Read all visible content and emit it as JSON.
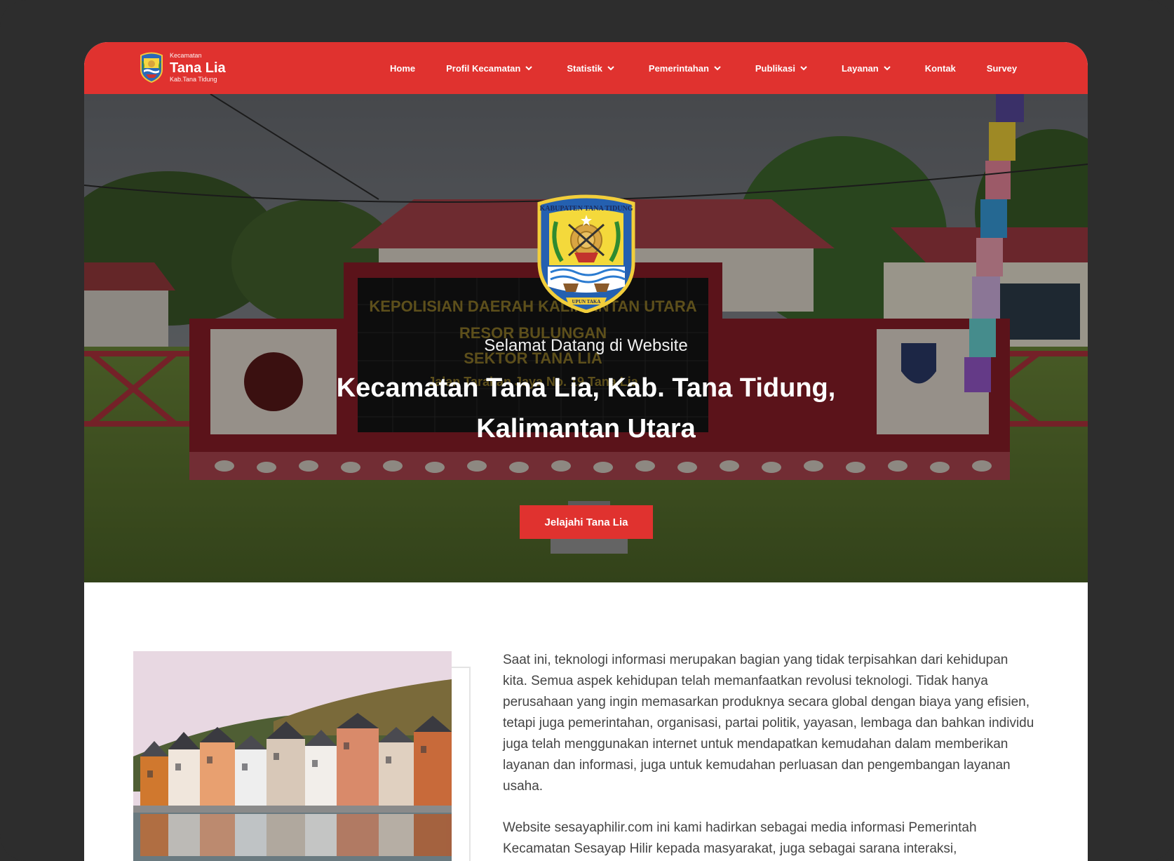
{
  "brand": {
    "small": "Kecamatan",
    "name": "Tana Lia",
    "sub": "Kab.Tana Tidung"
  },
  "nav": {
    "items": [
      {
        "label": "Home",
        "dropdown": false
      },
      {
        "label": "Profil Kecamatan",
        "dropdown": true
      },
      {
        "label": "Statistik",
        "dropdown": true
      },
      {
        "label": "Pemerintahan",
        "dropdown": true
      },
      {
        "label": "Publikasi",
        "dropdown": true
      },
      {
        "label": "Layanan",
        "dropdown": true
      },
      {
        "label": "Kontak",
        "dropdown": false
      },
      {
        "label": "Survey",
        "dropdown": false
      }
    ]
  },
  "hero": {
    "kicker": "Selamat Datang di Website",
    "title_line1": "Kecamatan Tana Lia, Kab. Tana Tidung,",
    "title_line2": "Kalimantan Utara",
    "button": "Jelajahi Tana Lia",
    "sign_line1": "KEPOLISIAN DAERAH KALIMANTAN UTARA",
    "sign_line2": "RESOR BULUNGAN",
    "sign_line3": "SEKTOR TANA LIA",
    "sign_line4": "Jalan Tarakan Jaya No. 19 Tana Lia",
    "crest_top": "KABUPATEN TANA TIDUNG",
    "crest_bottom": "UPUN TAKA"
  },
  "about": {
    "paragraph1": "Saat ini, teknologi informasi merupakan bagian yang tidak terpisahkan dari kehidupan kita. Semua aspek kehidupan telah memanfaatkan revolusi teknologi. Tidak hanya perusahaan yang ingin memasarkan produknya secara global dengan biaya yang efisien, tetapi juga pemerintahan, organisasi, partai politik, yayasan, lembaga dan bahkan individu juga telah menggunakan internet untuk mendapatkan kemudahan dalam memberikan layanan dan informasi, juga untuk kemudahan perluasan dan pengembangan layanan usaha.",
    "paragraph2": "Website sesayaphilir.com ini kami hadirkan sebagai media informasi Pemerintah Kecamatan Sesayap Hilir kepada masyarakat, juga sebagai sarana interaksi,"
  },
  "colors": {
    "brand_red": "#e0322f",
    "frame": "#2d2d2d"
  }
}
